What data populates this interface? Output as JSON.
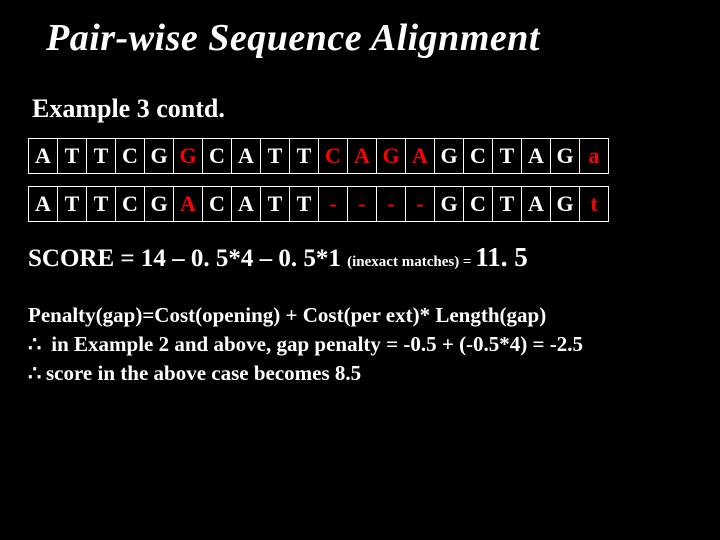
{
  "title": "Pair-wise Sequence Alignment",
  "subtitle": "Example 3  contd.",
  "row1": {
    "c0": "A",
    "c1": "T",
    "c2": "T",
    "c3": "C",
    "c4": "G",
    "c5": "G",
    "c6": "C",
    "c7": "A",
    "c8": "T",
    "c9": "T",
    "c10": "C",
    "c11": "A",
    "c12": "G",
    "c13": "A",
    "c14": "G",
    "c15": "C",
    "c16": "T",
    "c17": "A",
    "c18": "G",
    "c19": "a"
  },
  "row1_red": {
    "5": true,
    "10": true,
    "11": true,
    "12": true,
    "13": true,
    "19": true
  },
  "row2": {
    "c0": "A",
    "c1": "T",
    "c2": "T",
    "c3": "C",
    "c4": "G",
    "c5": "A",
    "c6": "C",
    "c7": "A",
    "c8": "T",
    "c9": "T",
    "c10": "-",
    "c11": "-",
    "c12": "-",
    "c13": "-",
    "c14": "G",
    "c15": "C",
    "c16": "T",
    "c17": "A",
    "c18": "G",
    "c19": "t"
  },
  "row2_red": {
    "5": true,
    "10": true,
    "11": true,
    "12": true,
    "13": true,
    "19": true
  },
  "score": {
    "prefix": "SCORE = 14 – 0. 5*4 – 0. 5*1 ",
    "note": "(inexact matches) = ",
    "result": "11. 5"
  },
  "penalty": {
    "line1": "Penalty(gap)=Cost(opening) + Cost(per ext)* Length(gap)",
    "line2": " in Example 2 and above, gap penalty   = -0.5 + (-0.5*4) = -2.5",
    "line3": "score in the above case becomes 8.5"
  },
  "therefore_symbol": "∴"
}
